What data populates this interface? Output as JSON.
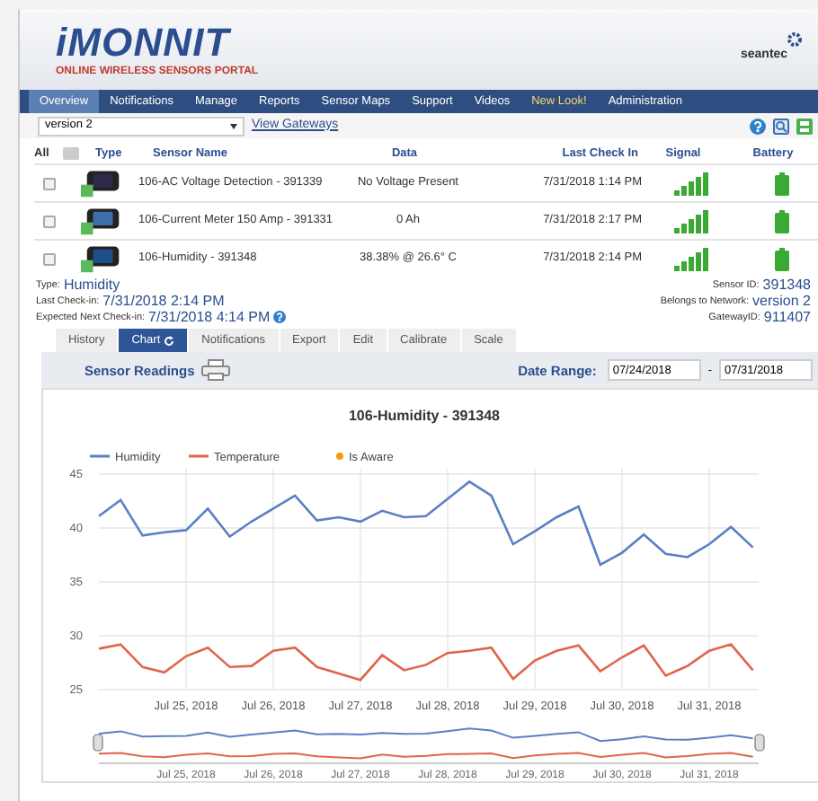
{
  "header": {
    "logo": "iMONNIT",
    "tagline": "ONLINE WIRELESS SENSORS PORTAL",
    "user": "seantec"
  },
  "nav": [
    {
      "label": "Overview",
      "selected": true,
      "kind": "normal"
    },
    {
      "label": "Notifications",
      "selected": false,
      "kind": "normal"
    },
    {
      "label": "Manage",
      "selected": false,
      "kind": "normal"
    },
    {
      "label": "Reports",
      "selected": false,
      "kind": "normal"
    },
    {
      "label": "Sensor Maps",
      "selected": false,
      "kind": "normal"
    },
    {
      "label": "Support",
      "selected": false,
      "kind": "normal"
    },
    {
      "label": "Videos",
      "selected": false,
      "kind": "normal"
    },
    {
      "label": "New Look!",
      "selected": false,
      "kind": "highlight"
    },
    {
      "label": "Administration",
      "selected": false,
      "kind": "normal"
    }
  ],
  "toolbar": {
    "network": "version 2",
    "link": "View Gateways"
  },
  "table": {
    "columns": [
      "All",
      "Type",
      "Sensor Name",
      "Data",
      "Last Check In",
      "Signal",
      "Battery"
    ],
    "all_checked": false,
    "rows": [
      {
        "checked": false,
        "name": "106-AC Voltage Detection - 391339",
        "data": "No Voltage Present",
        "last_check_in": "7/31/2018 1:14 PM"
      },
      {
        "checked": false,
        "name": "106-Current Meter 150 Amp - 391331",
        "data": "0 Ah",
        "last_check_in": "7/31/2018 2:17 PM"
      },
      {
        "checked": false,
        "name": "106-Humidity - 391348",
        "data": "38.38% @ 26.6° C",
        "last_check_in": "7/31/2018 2:14 PM"
      }
    ]
  },
  "details": {
    "left": [
      {
        "label": "Type:",
        "value": "Humidity"
      },
      {
        "label": "Last Check-in:",
        "value": "7/31/2018 2:14 PM"
      },
      {
        "label": "Expected Next Check-in:",
        "value": "7/31/2018 4:14 PM"
      }
    ],
    "right": [
      {
        "label": "Sensor ID:",
        "value": "391348"
      },
      {
        "label": "Belongs to Network:",
        "value": "version 2"
      },
      {
        "label": "GatewayID:",
        "value": "911407"
      }
    ]
  },
  "tabs": [
    {
      "label": "History",
      "selected": false
    },
    {
      "label": "Chart",
      "selected": true
    },
    {
      "label": "Notifications",
      "selected": false
    },
    {
      "label": "Export",
      "selected": false
    },
    {
      "label": "Edit",
      "selected": false
    },
    {
      "label": "Calibrate",
      "selected": false
    },
    {
      "label": "Scale",
      "selected": false
    }
  ],
  "readings": {
    "title": "Sensor Readings",
    "date_label": "Date Range:",
    "from": "07/24/2018",
    "separator": "-",
    "to": "07/31/2018",
    "chart_data": {
      "type": "line",
      "title": "106-Humidity - 391348",
      "categories": [
        null,
        null,
        null,
        null,
        "Jul 25, 2018",
        null,
        null,
        null,
        "Jul 26, 2018",
        null,
        null,
        null,
        "Jul 27, 2018",
        null,
        null,
        null,
        "Jul 28, 2018",
        null,
        null,
        null,
        "Jul 29, 2018",
        null,
        null,
        null,
        "Jul 30, 2018",
        null,
        null,
        null,
        "Jul 31, 2018",
        null,
        null
      ],
      "series": [
        {
          "name": "Humidity",
          "color": "#5b7fc4",
          "values": [
            41.1,
            42.6,
            39.3,
            39.6,
            39.8,
            41.8,
            39.2,
            40.6,
            41.8,
            43.0,
            40.7,
            41.0,
            40.6,
            41.6,
            41.0,
            41.1,
            42.7,
            44.3,
            43.0,
            38.5,
            39.7,
            41.0,
            42.0,
            36.6,
            37.7,
            39.4,
            37.6,
            37.3,
            38.5,
            40.1,
            38.2
          ]
        },
        {
          "name": "Temperature",
          "color": "#e0654a",
          "values": [
            28.8,
            29.2,
            27.1,
            26.6,
            28.1,
            28.9,
            27.1,
            27.2,
            28.6,
            28.9,
            27.1,
            26.5,
            25.9,
            28.2,
            26.8,
            27.3,
            28.4,
            28.6,
            28.9,
            26.0,
            27.7,
            28.6,
            29.1,
            26.7,
            28.0,
            29.1,
            26.3,
            27.2,
            28.6,
            29.2,
            26.8
          ]
        },
        {
          "name": "Is Aware",
          "color": "#f39c12",
          "values": [
            null,
            null,
            null,
            null,
            null,
            null,
            null,
            null,
            null,
            null,
            null,
            null,
            null,
            null,
            null,
            null,
            null,
            null,
            null,
            null,
            null,
            null,
            null,
            null,
            null,
            null,
            null,
            null,
            null,
            null,
            null
          ]
        }
      ],
      "ylim": [
        25,
        45
      ],
      "yticks": [
        25,
        30,
        35,
        40,
        45
      ],
      "grid": true,
      "legend": "top"
    },
    "navigator_labels": [
      "Jul 25, 2018",
      "Jul 26, 2018",
      "Jul 27, 2018",
      "Jul 28, 2018",
      "Jul 29, 2018",
      "Jul 30, 2018",
      "Jul 31, 2018"
    ]
  }
}
